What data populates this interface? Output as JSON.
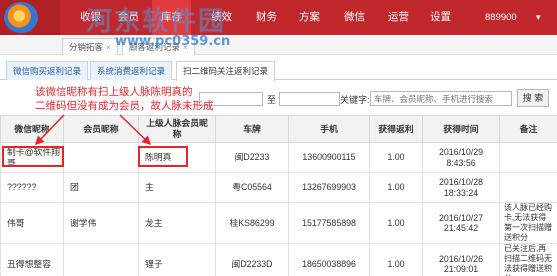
{
  "topnav": {
    "items": [
      "收银",
      "会员",
      "库存",
      "绩效",
      "财务",
      "方案",
      "微信",
      "运营",
      "设置",
      "889900"
    ],
    "active_index": 2,
    "watermark_title": "河东软件园",
    "watermark_url": "www.pc0359.cn"
  },
  "tabs_top": [
    {
      "label": "分销拓客",
      "close": "×"
    },
    {
      "label": "顾客返利记录",
      "close": "×"
    }
  ],
  "tabs_sub": [
    {
      "label": "微信购买返利记录"
    },
    {
      "label": "系统消费返利记录"
    },
    {
      "label": "扫二维码关注返利记录"
    }
  ],
  "filter": {
    "to_label": "至",
    "keyword_label": "关键字:",
    "keyword_placeholder": "车牌、会员昵称、手机进行搜索",
    "search_button": "搜 索"
  },
  "annotation": {
    "line1": "该微信昵称有扫上级人脉陈明真的",
    "line2": "二维码但没有成为会员，故人脉未形成"
  },
  "table": {
    "headers": [
      "微信昵称",
      "会员昵称",
      "上级人脉会员昵称",
      "车牌",
      "手机",
      "获得返利",
      "获得时间",
      "备注"
    ],
    "rows": [
      [
        "制卡@软件翔哥",
        "",
        "陈明真",
        "闽D2233",
        "13600900115",
        "1.00",
        "2016/10/29\n8:43:56",
        ""
      ],
      [
        "??????",
        "团",
        "主",
        "粤C05564",
        "13267699903",
        "1.00",
        "2016/10/28\n18:33:24",
        ""
      ],
      [
        "伟哥",
        "谢学伟",
        "龙主",
        "桂KS86299",
        "15177585898",
        "1.00",
        "2016/10/27\n21:45:42",
        "该人脉已经购卡,无法获得第一次扫描赠送积分"
      ],
      [
        "丑得想整容",
        "",
        "锂子",
        "闽D2233D",
        "18650038896",
        "1.00",
        "2016/10/26\n21:09:01",
        "已关注后,再扫描二维码无法获得赠送积分"
      ]
    ]
  },
  "colors": {
    "nav_red": "#c0282d",
    "annotation_red": "#e2262c",
    "tab_blue": "#1f5fa0"
  }
}
